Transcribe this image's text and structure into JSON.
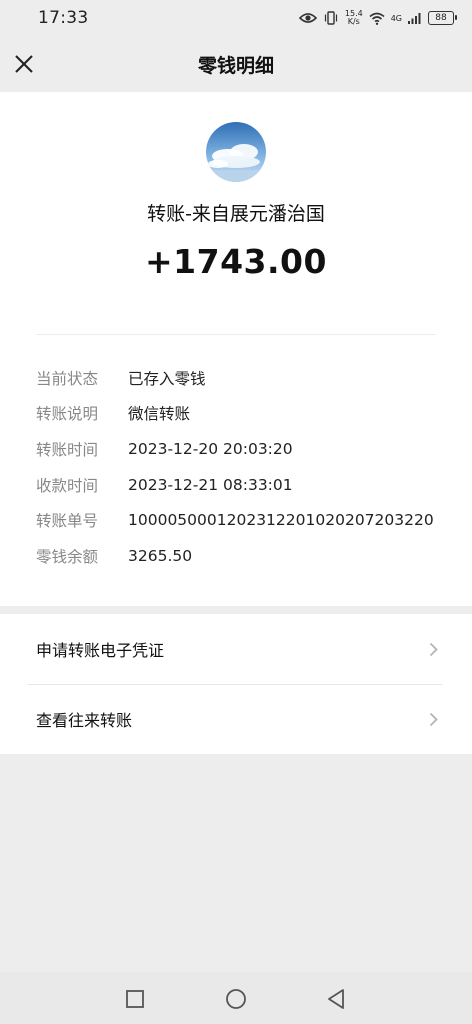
{
  "status_bar": {
    "time": "17:33",
    "net_speed_value": "15.4",
    "net_speed_unit": "K/s",
    "network_type": "4G",
    "battery": "88"
  },
  "nav": {
    "title": "零钱明细"
  },
  "transaction": {
    "title": "转账-来自展元潘治国",
    "amount": "+1743.00"
  },
  "details": [
    {
      "label": "当前状态",
      "value": "已存入零钱"
    },
    {
      "label": "转账说明",
      "value": "微信转账"
    },
    {
      "label": "转账时间",
      "value": "2023-12-20 20:03:20"
    },
    {
      "label": "收款时间",
      "value": "2023-12-21 08:33:01"
    },
    {
      "label": "转账单号",
      "value": "1000050001202312201020207203220"
    },
    {
      "label": "零钱余额",
      "value": "3265.50"
    }
  ],
  "actions": [
    {
      "label": "申请转账电子凭证"
    },
    {
      "label": "查看往来转账"
    }
  ],
  "colors": {
    "page_bg": "#ededed",
    "card_bg": "#ffffff",
    "label_gray": "#888888",
    "text_dark": "#111111"
  }
}
